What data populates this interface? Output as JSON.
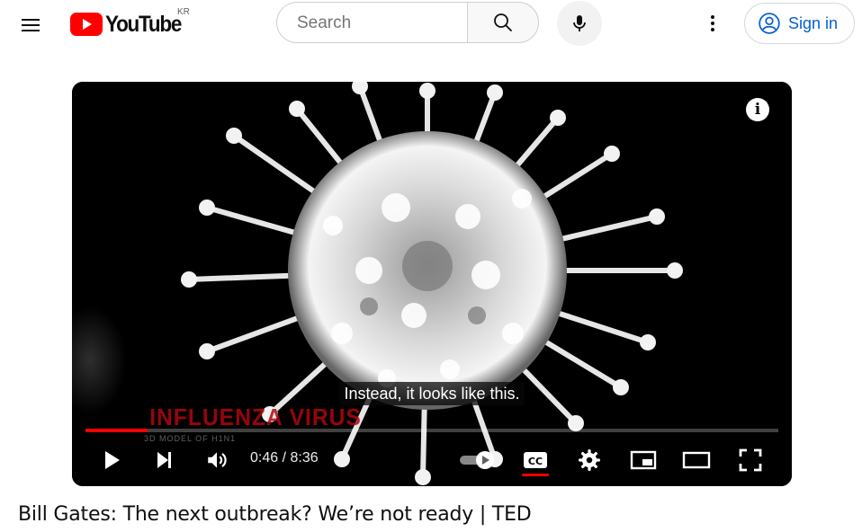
{
  "masthead": {
    "logo_text": "YouTube",
    "country_code": "KR",
    "search_placeholder": "Search",
    "signin_label": "Sign in",
    "brand_color": "#ff0000",
    "link_color": "#065fd4"
  },
  "player": {
    "caption": "Instead, it looks like this.",
    "watermark_title": "INFLUENZA VIRUS",
    "watermark_subtitle": "3D MODEL OF H1N1",
    "current_time": "0:46",
    "duration": "8:36",
    "time_display": "0:46 / 8:36",
    "progress_fraction": 0.0891,
    "captions_on": true,
    "icons": [
      "play-icon",
      "next-icon",
      "volume-icon",
      "autoplay-toggle",
      "cc-icon",
      "settings-icon",
      "miniplayer-icon",
      "theater-icon",
      "fullscreen-icon",
      "info-icon"
    ]
  },
  "video": {
    "title": "Bill Gates: The next outbreak? We’re not ready | TED"
  }
}
